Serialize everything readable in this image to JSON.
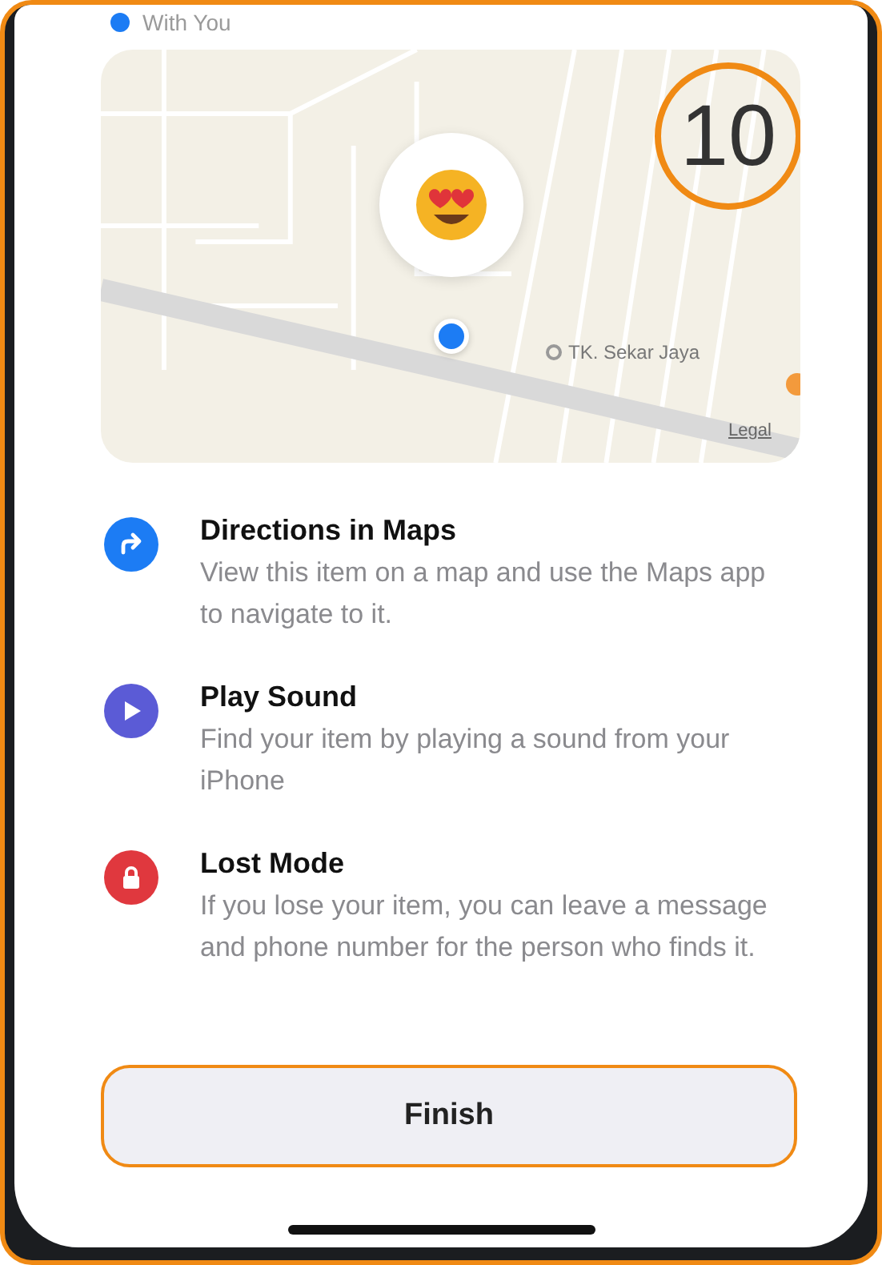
{
  "status_row": {
    "label": "With You"
  },
  "map": {
    "poi_label": "TK. Sekar Jaya",
    "legal_link": "Legal"
  },
  "step_badge": "10",
  "features": [
    {
      "kind": "directions",
      "title": "Directions in Maps",
      "description": "View this item on a map and use the Maps app to navigate to it.",
      "color": "#1c7cf4"
    },
    {
      "kind": "sound",
      "title": "Play Sound",
      "description": "Find your item by playing a sound from your iPhone",
      "color": "#5b5bd6"
    },
    {
      "kind": "lost",
      "title": "Lost Mode",
      "description": "If you lose your item, you can leave a message and phone number for the person who finds it.",
      "color": "#e0383e"
    }
  ],
  "finish_button": "Finish"
}
